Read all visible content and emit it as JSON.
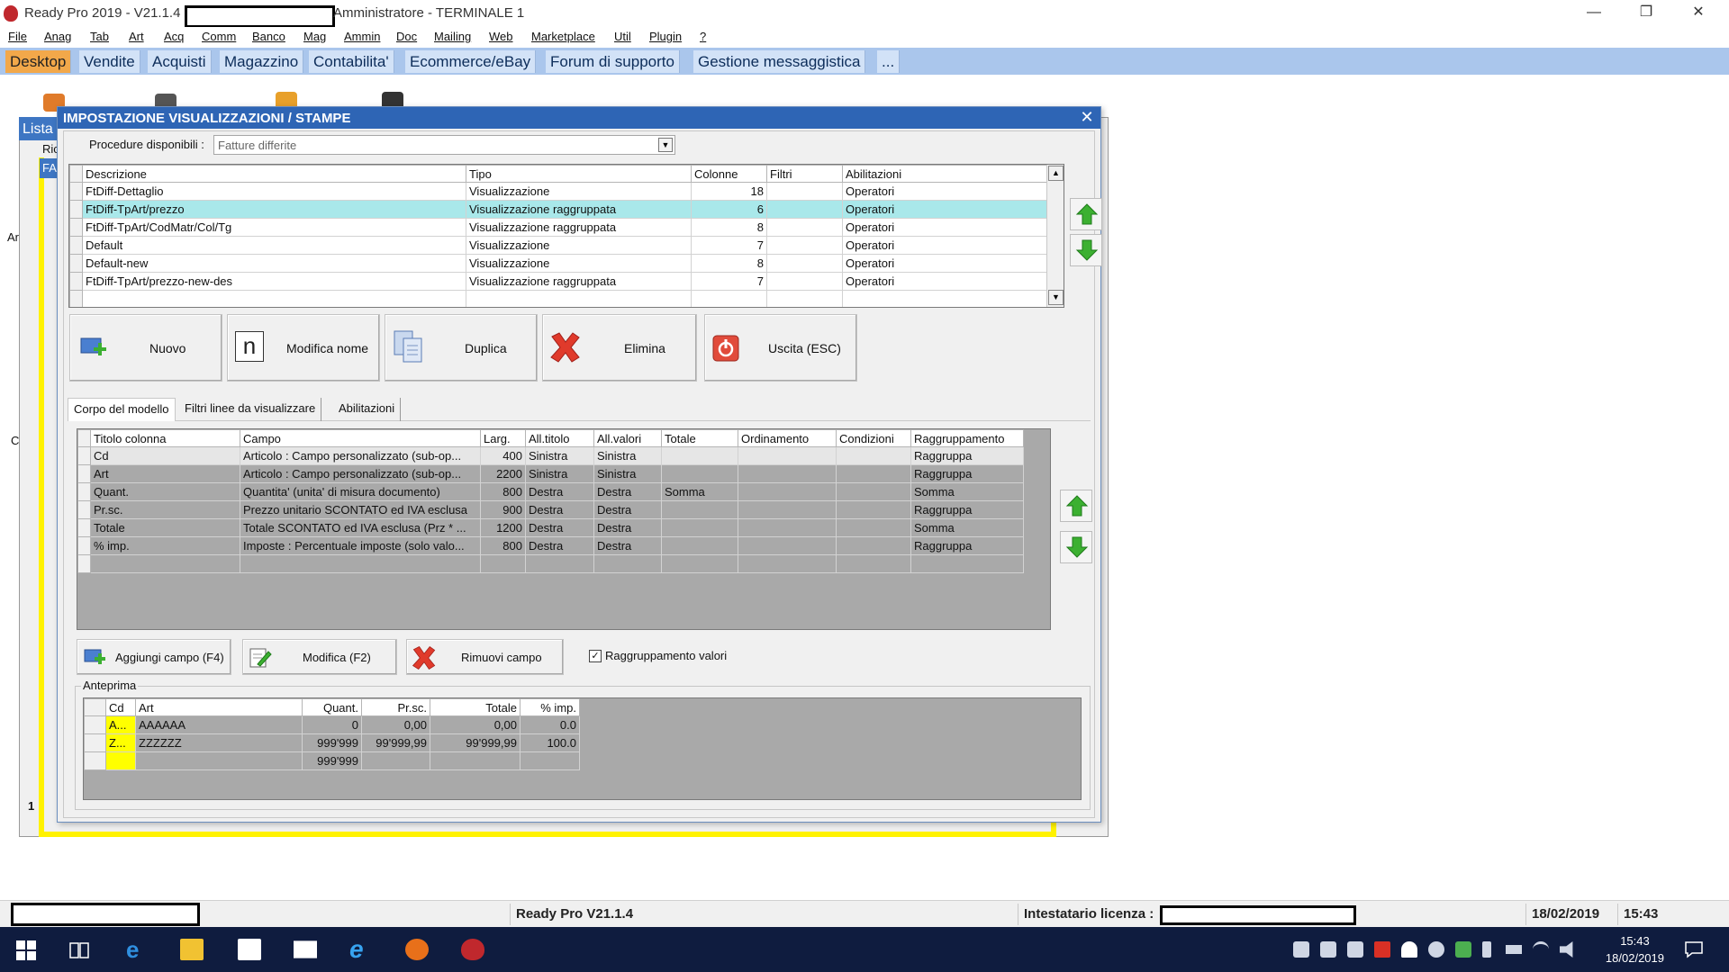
{
  "window": {
    "title_left": "Ready Pro 2019 - V21.1.4 -",
    "title_right": "Amministratore - TERMINALE 1",
    "min_glyph": "—",
    "max_glyph": "❐",
    "close_glyph": "✕"
  },
  "menu": [
    "File",
    "Anag",
    "Tab",
    "Art",
    "Acq",
    "Comm",
    "Banco",
    "Mag",
    "Ammin",
    "Doc",
    "Mailing",
    "Web",
    "Marketplace",
    "Util",
    "Plugin",
    "?"
  ],
  "tabs": [
    "Desktop",
    "Vendite",
    "Acquisti",
    "Magazzino",
    "Contabilita'",
    "Ecommerce/eBay",
    "Forum di supporto",
    "Gestione messaggistica",
    "..."
  ],
  "background": {
    "window_title": "Lista",
    "frag_ric": "Ric",
    "frag_fa": "FA",
    "frag_ar": "Ar",
    "frag_c": "C",
    "frag_1": "1"
  },
  "dialog": {
    "title": "IMPOSTAZIONE VISUALIZZAZIONI / STAMPE",
    "close_glyph": "✕",
    "procedure_label": "Procedure disponibili :",
    "procedure_value": "Fatture differite",
    "views_grid": {
      "headers": [
        "Descrizione",
        "Tipo",
        "Colonne",
        "Filtri",
        "Abilitazioni"
      ],
      "rows": [
        {
          "desc": "FtDiff-Dettaglio",
          "tipo": "Visualizzazione",
          "colonne": "18",
          "filtri": "",
          "abil": "Operatori"
        },
        {
          "desc": "FtDiff-TpArt/prezzo",
          "tipo": "Visualizzazione raggruppata",
          "colonne": "6",
          "filtri": "",
          "abil": "Operatori"
        },
        {
          "desc": "FtDiff-TpArt/CodMatr/Col/Tg",
          "tipo": "Visualizzazione raggruppata",
          "colonne": "8",
          "filtri": "",
          "abil": "Operatori"
        },
        {
          "desc": "Default",
          "tipo": "Visualizzazione",
          "colonne": "7",
          "filtri": "",
          "abil": "Operatori"
        },
        {
          "desc": "Default-new",
          "tipo": "Visualizzazione",
          "colonne": "8",
          "filtri": "",
          "abil": "Operatori"
        },
        {
          "desc": "FtDiff-TpArt/prezzo-new-des",
          "tipo": "Visualizzazione raggruppata",
          "colonne": "7",
          "filtri": "",
          "abil": "Operatori"
        }
      ],
      "selected_index": 1
    },
    "action_buttons": {
      "nuovo": "Nuovo",
      "modifica_nome": "Modifica nome",
      "modifica_nome_glyph": "n",
      "duplica": "Duplica",
      "elimina": "Elimina",
      "uscita": "Uscita (ESC)"
    },
    "subtabs": [
      "Corpo del modello",
      "Filtri linee da visualizzare",
      "Abilitazioni"
    ],
    "fields_grid": {
      "headers": [
        "Titolo colonna",
        "Campo",
        "Larg.",
        "All.titolo",
        "All.valori",
        "Totale",
        "Ordinamento",
        "Condizioni",
        "Raggruppamento"
      ],
      "rows": [
        {
          "titolo": "Cd",
          "campo": "Articolo : Campo personalizzato (sub-op...",
          "larg": "400",
          "alltit": "Sinistra",
          "allval": "Sinistra",
          "totale": "",
          "ord": "",
          "cond": "",
          "ragg": "Raggruppa"
        },
        {
          "titolo": "Art",
          "campo": "Articolo : Campo personalizzato (sub-op...",
          "larg": "2200",
          "alltit": "Sinistra",
          "allval": "Sinistra",
          "totale": "",
          "ord": "",
          "cond": "",
          "ragg": "Raggruppa"
        },
        {
          "titolo": "Quant.",
          "campo": "Quantita' (unita' di misura documento)",
          "larg": "800",
          "alltit": "Destra",
          "allval": "Destra",
          "totale": "Somma",
          "ord": "",
          "cond": "",
          "ragg": "Somma"
        },
        {
          "titolo": "Pr.sc.",
          "campo": "Prezzo unitario SCONTATO ed IVA esclusa",
          "larg": "900",
          "alltit": "Destra",
          "allval": "Destra",
          "totale": "",
          "ord": "",
          "cond": "",
          "ragg": "Raggruppa"
        },
        {
          "titolo": "Totale",
          "campo": "Totale SCONTATO ed IVA esclusa (Prz * ...",
          "larg": "1200",
          "alltit": "Destra",
          "allval": "Destra",
          "totale": "",
          "ord": "",
          "cond": "",
          "ragg": "Somma"
        },
        {
          "titolo": "% imp.",
          "campo": "Imposte : Percentuale imposte (solo valo...",
          "larg": "800",
          "alltit": "Destra",
          "allval": "Destra",
          "totale": "",
          "ord": "",
          "cond": "",
          "ragg": "Raggruppa"
        }
      ]
    },
    "field_buttons": {
      "aggiungi": "Aggiungi campo (F4)",
      "modifica": "Modifica (F2)",
      "rimuovi": "Rimuovi campo"
    },
    "raggruppamento_label": "Raggruppamento valori",
    "raggruppamento_checked": true,
    "check_glyph": "✓",
    "preview": {
      "label": "Anteprima",
      "headers": [
        "Cd",
        "Art",
        "Quant.",
        "Pr.sc.",
        "Totale",
        "% imp."
      ],
      "rows": [
        {
          "cd": "A...",
          "art": "AAAAAA",
          "quant": "0",
          "prsc": "0,00",
          "totale": "0,00",
          "imp": "0.0"
        },
        {
          "cd": "Z...",
          "art": "ZZZZZZ",
          "quant": "999'999",
          "prsc": "99'999,99",
          "totale": "99'999,99",
          "imp": "100.0"
        },
        {
          "cd": "",
          "art": "",
          "quant": "999'999",
          "prsc": "",
          "totale": "",
          "imp": ""
        }
      ]
    }
  },
  "statusbar": {
    "version": "Ready Pro V21.1.4",
    "licensee_label": "Intestatario licenza :",
    "date": "18/02/2019",
    "time": "15:43"
  },
  "taskbar": {
    "clock_time": "15:43",
    "clock_date": "18/02/2019"
  },
  "colors": {
    "title_blue": "#2e65b5",
    "tabbar": "#aac6ec",
    "active_tab": "#f2a84a",
    "selected_row": "#a9e8ea",
    "taskbar": "#0f1c3f",
    "preview_yellow": "#ffff00",
    "arrow_green": "#3cb031",
    "delete_red": "#e03a2b"
  }
}
